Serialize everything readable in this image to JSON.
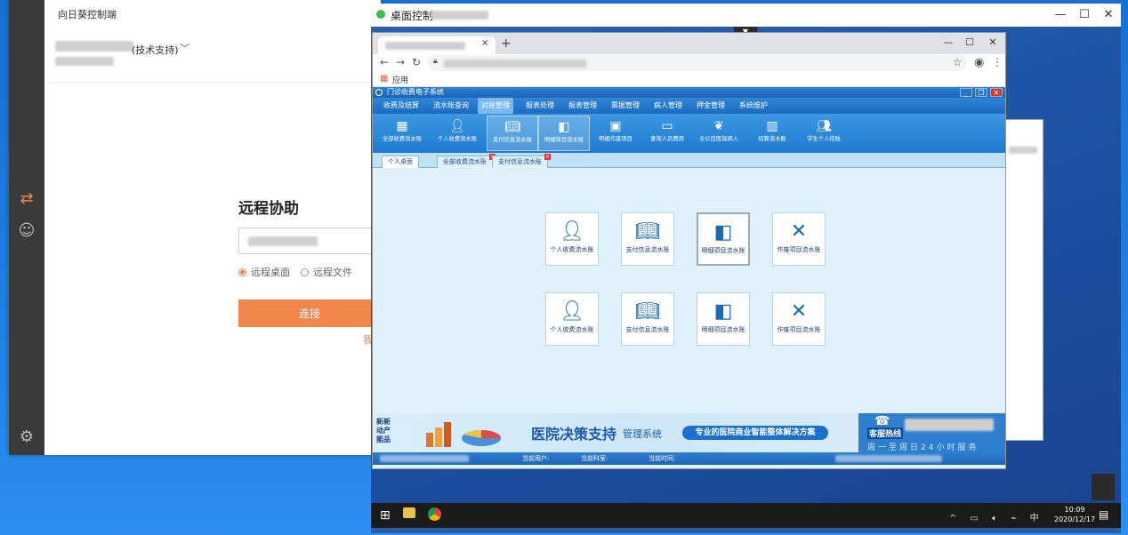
{
  "sunflower": {
    "title": "向日葵控制端",
    "account_label": "(技术支持)",
    "remote_heading": "远程协助",
    "radio_desktop": "远程桌面",
    "radio_file": "远程文件",
    "connect_button": "连接",
    "extra_link": "我",
    "selected_mode": "远程桌面"
  },
  "desktop": {
    "title": "桌面控制",
    "minimize": "—",
    "maximize": "☐",
    "close": "✕",
    "taskbar": {
      "time": "10:09",
      "date": "2020/12/17",
      "ime": "中"
    }
  },
  "chrome": {
    "new_tab": "+",
    "tab_close": "×",
    "bookmark_apps": "应用"
  },
  "his": {
    "title": "门诊收费电子系统",
    "menus": [
      {
        "label": "收费及结算",
        "active": false
      },
      {
        "label": "流水账查询",
        "active": false
      },
      {
        "label": "对账管理",
        "active": true
      },
      {
        "label": "报表处理",
        "active": false
      },
      {
        "label": "报表管理",
        "active": false
      },
      {
        "label": "票据管理",
        "active": false
      },
      {
        "label": "病人管理",
        "active": false
      },
      {
        "label": "押金管理",
        "active": false
      },
      {
        "label": "系统维护",
        "active": false
      }
    ],
    "tools": [
      {
        "label": "全部收费流水账",
        "icon": "grid-icon",
        "active": false
      },
      {
        "label": "个人收费流水账",
        "icon": "person-icon",
        "active": false
      },
      {
        "label": "支付信息流水账",
        "icon": "book-icon",
        "active": true
      },
      {
        "label": "明细项目流水账",
        "icon": "chart-card-icon",
        "active": true
      },
      {
        "label": "明细作废项目",
        "icon": "id-card-icon",
        "active": false
      },
      {
        "label": "查询人员费用",
        "icon": "monitor-icon",
        "active": false
      },
      {
        "label": "全公目医保病人",
        "icon": "leaf-icon",
        "active": false
      },
      {
        "label": "结算流水账",
        "icon": "calculator-icon",
        "active": false
      },
      {
        "label": "学生个人结账",
        "icon": "people-icon",
        "active": false
      }
    ],
    "page_tabs": [
      {
        "label": "个人桌面",
        "active": true,
        "closable": false
      },
      {
        "label": "全部收费流水账",
        "active": false,
        "closable": true
      },
      {
        "label": "支付信息流水账",
        "active": false,
        "closable": true
      }
    ],
    "tiles": [
      {
        "label": "个人收费流水账",
        "icon": "person-icon",
        "active": false
      },
      {
        "label": "支付信息流水账",
        "icon": "book-icon",
        "active": false
      },
      {
        "label": "明细项目流水账",
        "icon": "chart-card-icon",
        "active": true
      },
      {
        "label": "作废项目流水账",
        "icon": "excel-icon",
        "active": false
      },
      {
        "label": "个人收费流水账",
        "icon": "person-icon",
        "active": false
      },
      {
        "label": "支付信息流水账",
        "icon": "book-icon",
        "active": false
      },
      {
        "label": "明细项目流水账",
        "icon": "chart-card-icon",
        "active": false
      },
      {
        "label": "作废项目流水账",
        "icon": "excel-icon",
        "active": false
      }
    ],
    "banner": {
      "left_text": "新新动产能品",
      "title": "医院决策支持",
      "subtitle": "管理系统",
      "slogan": "专业的医院商业智能整体解决方案",
      "hotline_label": "客服热线",
      "hotline_hours": "周一至周日24小时服务"
    },
    "status": {
      "user": "当前用户:",
      "dept": "当前科室:",
      "time": "当前时间:"
    }
  },
  "colors": {
    "accent_orange": "#f3864b",
    "his_blue": "#1f7bd0",
    "online_green": "#3cbf4a"
  }
}
